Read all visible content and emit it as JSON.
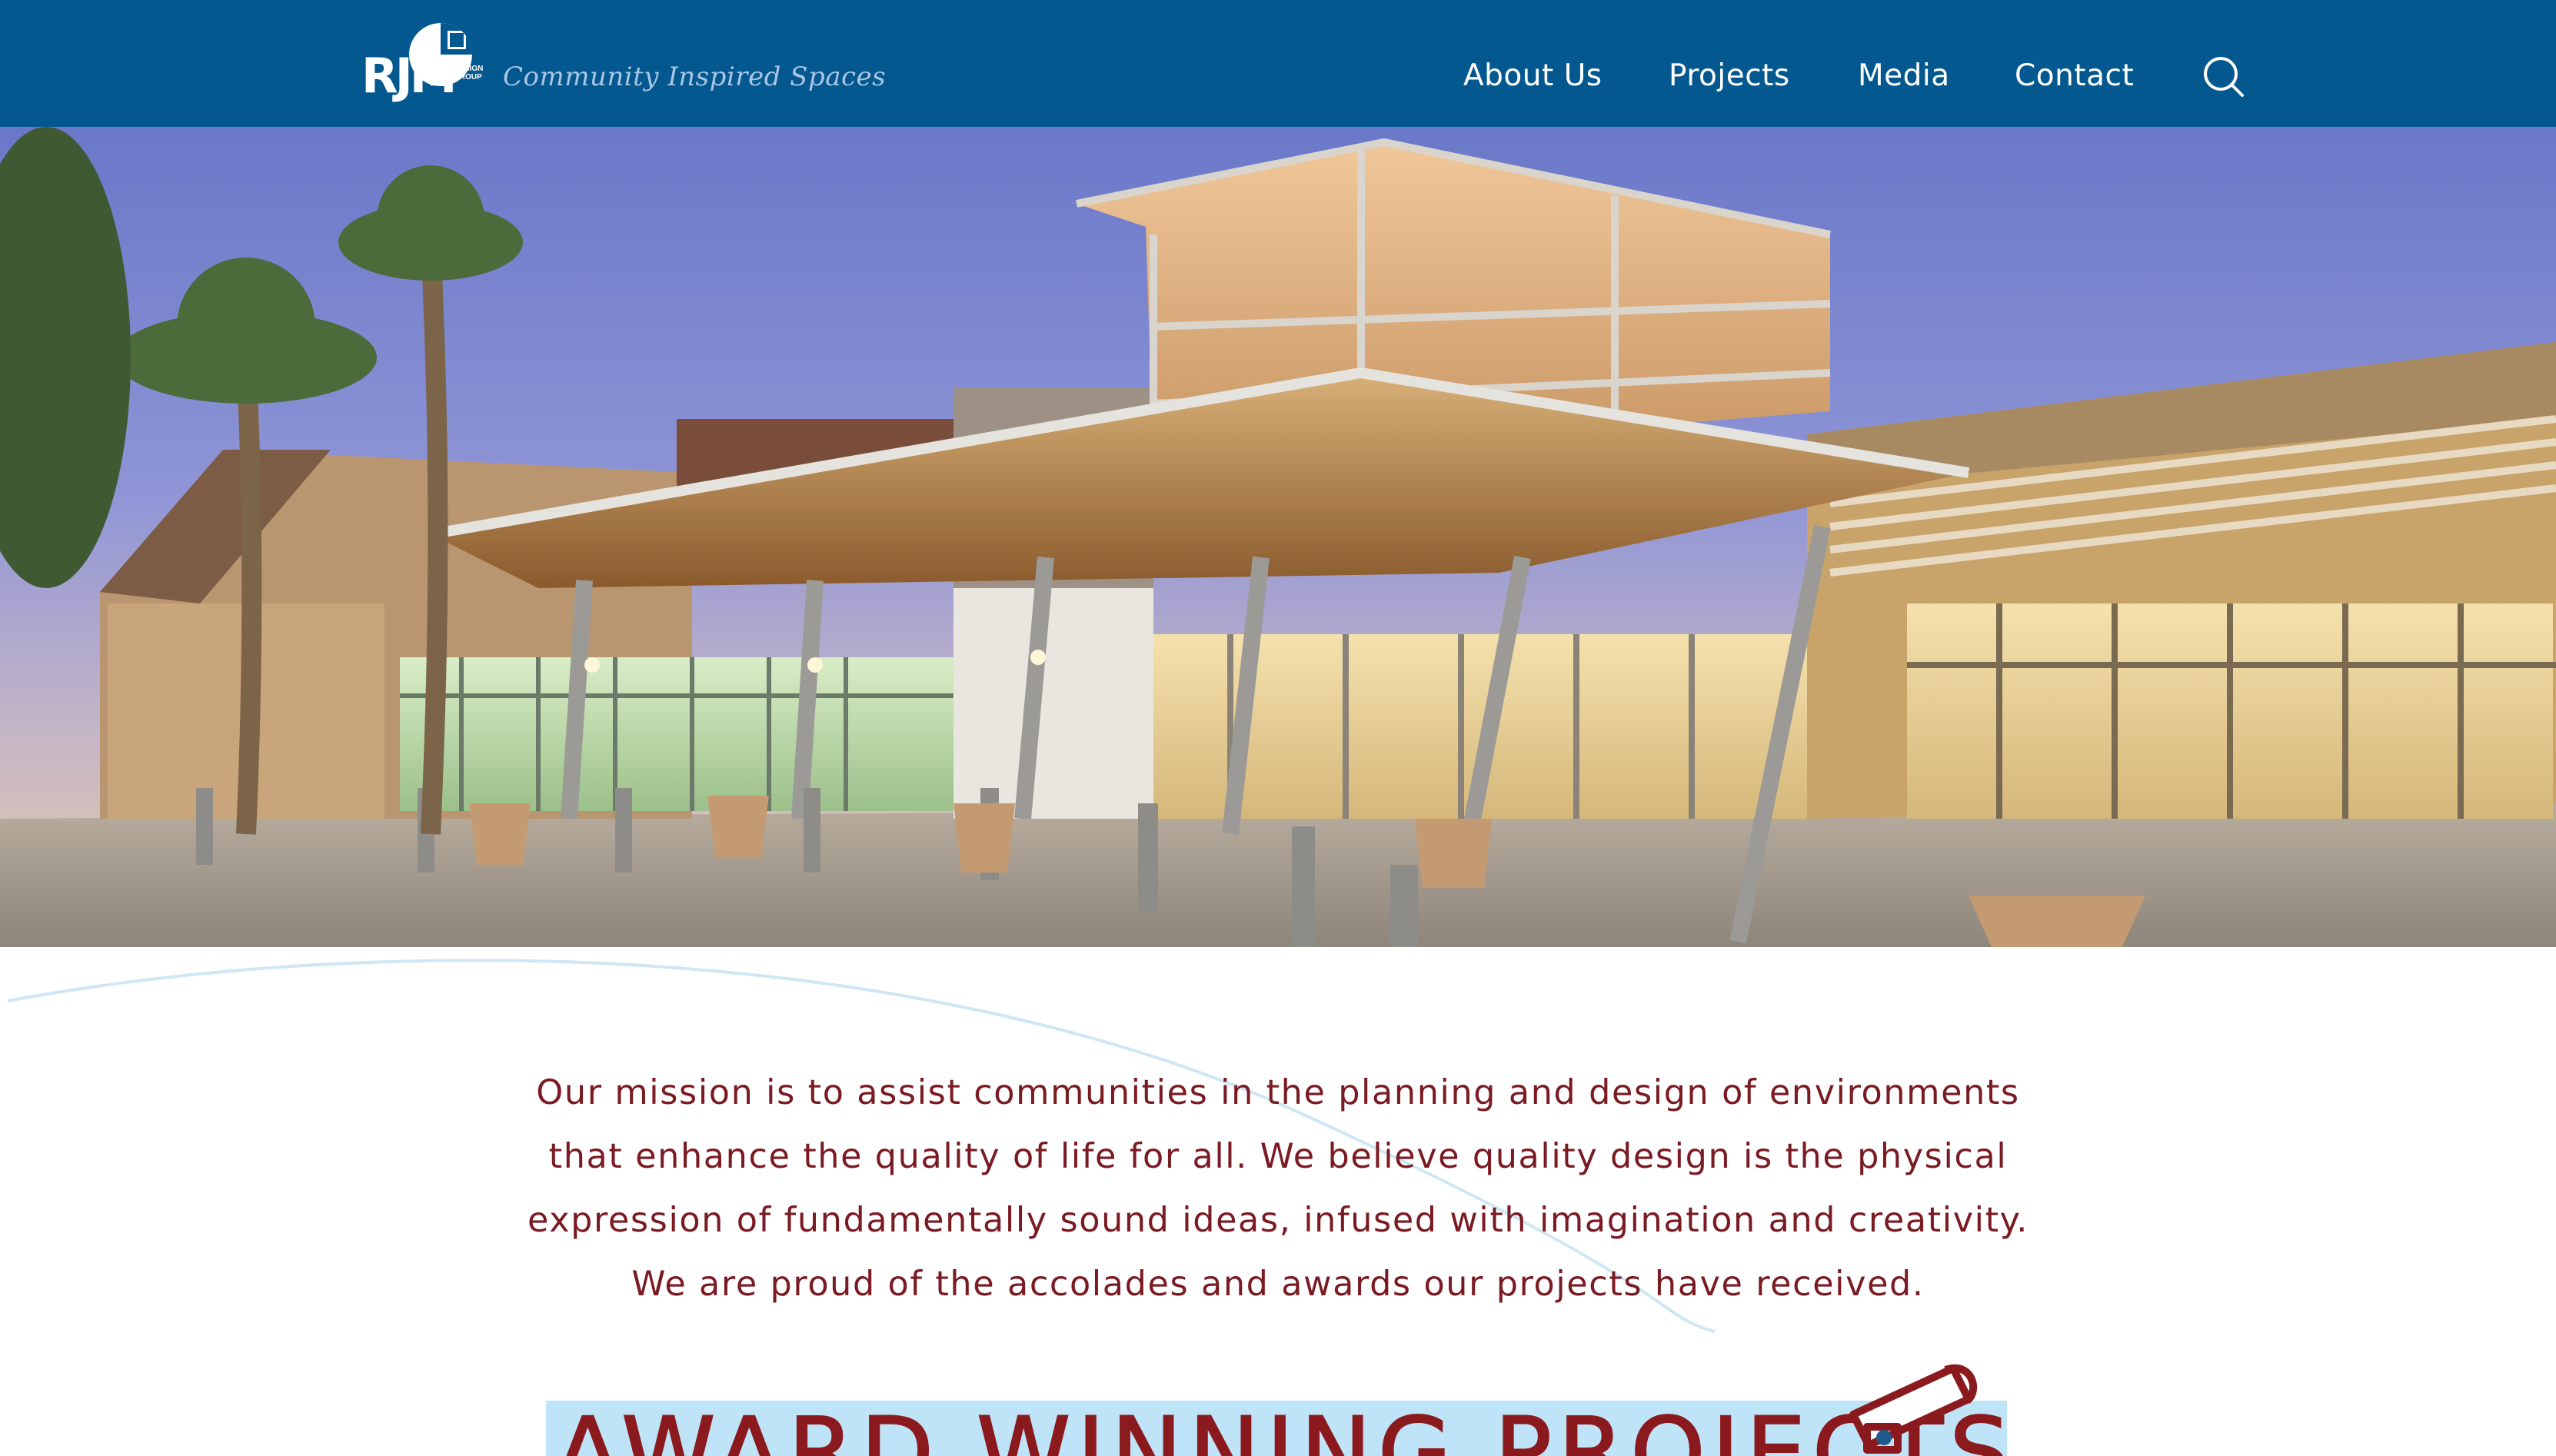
{
  "header": {
    "logo_text": "RJM",
    "logo_sub_lines": [
      "DESIGN",
      "GROUP"
    ],
    "tagline": "Community Inspired Spaces",
    "nav": [
      {
        "label": "About Us"
      },
      {
        "label": "Projects"
      },
      {
        "label": "Media"
      },
      {
        "label": "Contact"
      }
    ],
    "search_icon": "search-icon",
    "background_color": "#03588f"
  },
  "hero": {
    "image_description_icon": "hero-photo"
  },
  "mission": {
    "lines": [
      "Our mission is to assist communities in the planning and design of environments",
      "that enhance the quality of life for all. We believe quality design is the physical",
      "expression of fundamentally sound ideas, infused with imagination and creativity.",
      "We are proud of the accolades and awards our projects have received."
    ],
    "text_color": "#7a1a22"
  },
  "awards": {
    "banner_text": "AWARD WINNING PROJECTS",
    "icon": "megaphone-icon",
    "band_color": "#bfe3f7"
  }
}
